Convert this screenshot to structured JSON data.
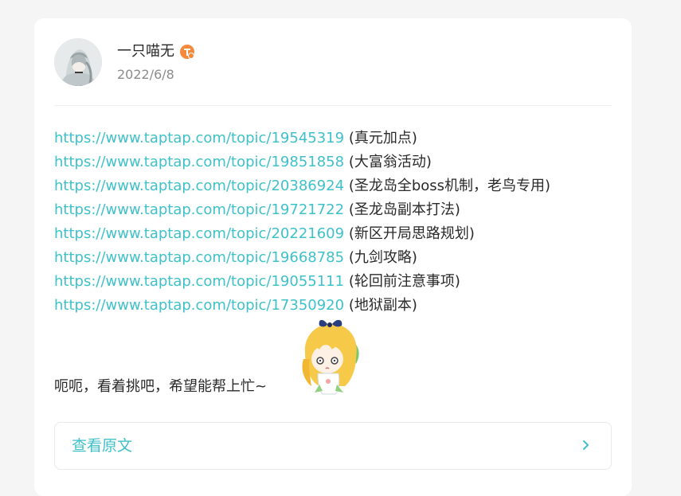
{
  "post": {
    "author": {
      "name": "一只喵无",
      "badge_icon": "verified-badge-icon",
      "avatar_icon": "anime-avatar"
    },
    "date": "2022/6/8",
    "links": [
      {
        "url": "https://www.taptap.com/topic/19545319",
        "note": "(真元加点)"
      },
      {
        "url": "https://www.taptap.com/topic/19851858",
        "note": "(大富翁活动)"
      },
      {
        "url": "https://www.taptap.com/topic/20386924",
        "note": "(圣龙岛全boss机制，老鸟专用)"
      },
      {
        "url": "https://www.taptap.com/topic/19721722",
        "note": "(圣龙岛副本打法)"
      },
      {
        "url": "https://www.taptap.com/topic/20221609",
        "note": "(新区开局思路规划)"
      },
      {
        "url": "https://www.taptap.com/topic/19668785",
        "note": "(九剑攻略)"
      },
      {
        "url": "https://www.taptap.com/topic/19055111",
        "note": "(轮回前注意事项)"
      },
      {
        "url": "https://www.taptap.com/topic/17350920",
        "note": "(地狱副本)"
      }
    ],
    "closing_text": "呃呃，看着挑吧，希望能帮上忙~",
    "sticker_icon": "anime-girl-sticker",
    "view_original": {
      "label": "查看原文",
      "icon": "chevron-right-icon"
    }
  },
  "colors": {
    "accent": "#3fc1c9",
    "text": "#2a2a2a",
    "muted": "#8c8c8c",
    "badge": "#f5893c",
    "background": "#f5f5f5"
  }
}
